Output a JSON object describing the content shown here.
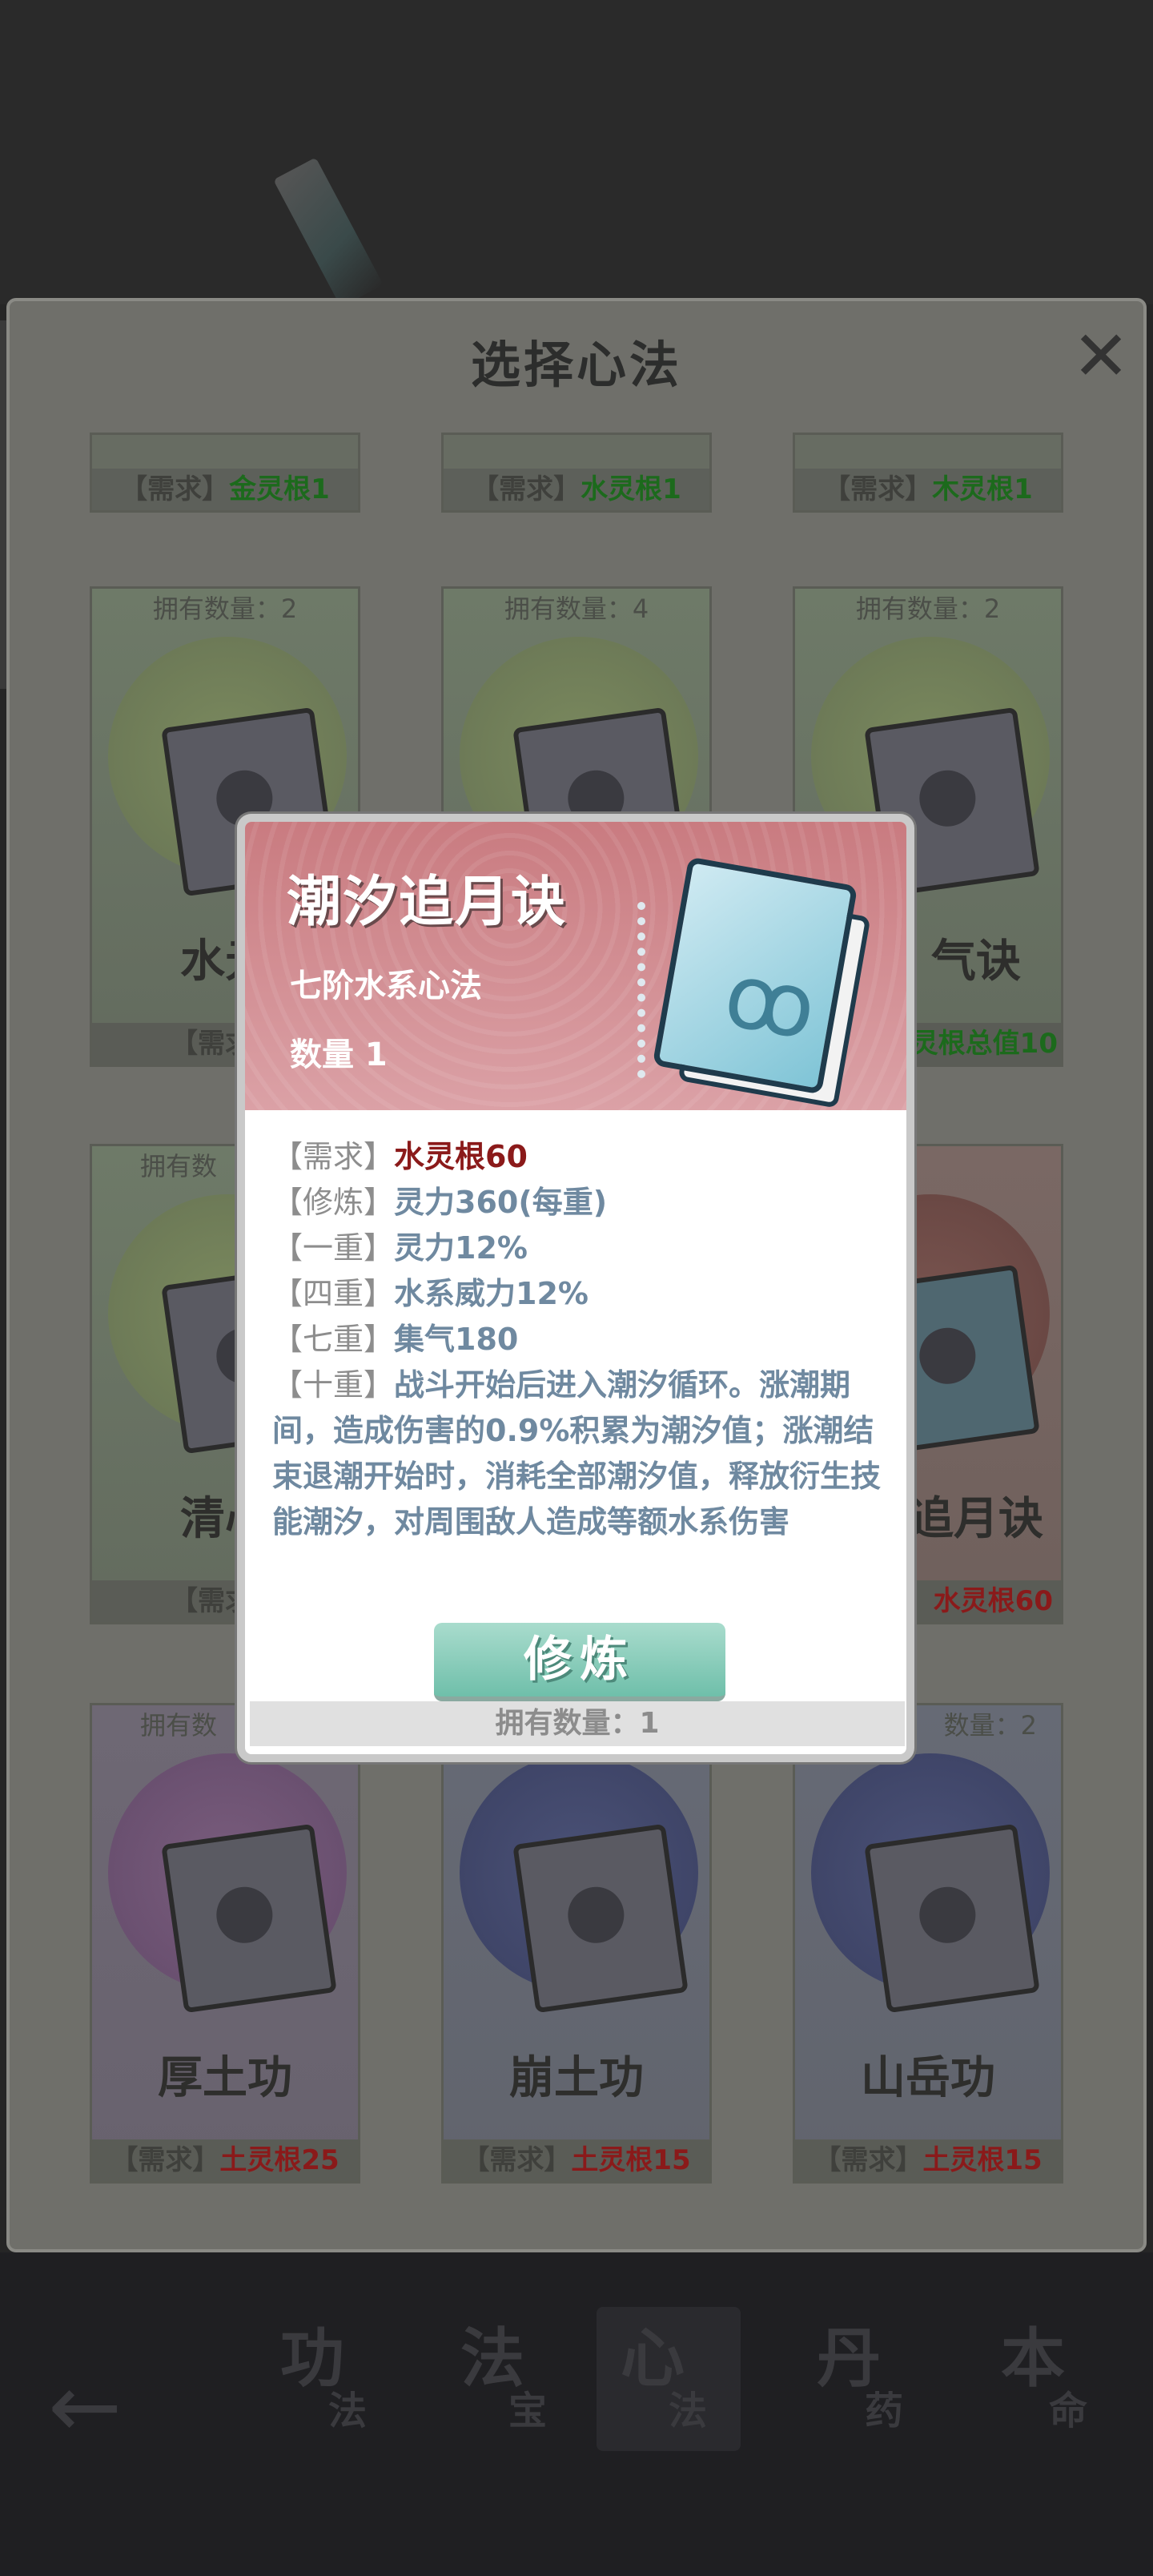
{
  "title": "选择心法",
  "top_row": [
    {
      "req_tag": "【需求】",
      "req_value": "金灵根1"
    },
    {
      "req_tag": "【需求】",
      "req_value": "水灵根1"
    },
    {
      "req_tag": "【需求】",
      "req_value": "木灵根1"
    }
  ],
  "row1": [
    {
      "owned": "拥有数量：2",
      "name": "水元",
      "req_tag": "【需求】",
      "req_value": ""
    },
    {
      "owned": "拥有数量：4",
      "name": "",
      "req_tag": "",
      "req_value": ""
    },
    {
      "owned": "拥有数量：2",
      "name": "气诀",
      "req_tag": "",
      "req_value": "灵根总值10"
    }
  ],
  "row2": [
    {
      "owned": "拥有数",
      "name": "清心",
      "req_tag": "【需求】",
      "req_value": ""
    },
    {
      "owned": "",
      "name": "追月诀",
      "req_tag": "",
      "req_value": "水灵根60"
    }
  ],
  "row3": [
    {
      "owned": "拥有数",
      "name": "厚土功",
      "req_tag": "【需求】",
      "req_value": "土灵根25"
    },
    {
      "owned": "",
      "name": "崩土功",
      "req_tag": "【需求】",
      "req_value": "土灵根15"
    },
    {
      "owned": "数量：2",
      "name": "山岳功",
      "req_tag": "【需求】",
      "req_value": "土灵根15"
    }
  ],
  "nav": {
    "tabs": [
      {
        "big": "功",
        "small": "法"
      },
      {
        "big": "法",
        "small": "宝"
      },
      {
        "big": "心",
        "small": "法"
      },
      {
        "big": "丹",
        "small": "药"
      },
      {
        "big": "本",
        "small": "命"
      }
    ]
  },
  "popup": {
    "title": "潮汐追月诀",
    "subtitle": "七阶水系心法",
    "quantity": "数量 1",
    "lines": [
      {
        "tag": "【需求】",
        "value": "水灵根60"
      },
      {
        "tag": "【修炼】",
        "value": "灵力360(每重)"
      },
      {
        "tag": "【一重】",
        "value": "灵力12%"
      },
      {
        "tag": "【四重】",
        "value": "水系威力12%"
      },
      {
        "tag": "【七重】",
        "value": "集气180"
      }
    ],
    "tenth_tag": "【十重】",
    "tenth_text": "战斗开始后进入潮汐循环。涨潮期间，造成伤害的0.9%积累为潮汐值；涨潮结束退潮开始时，消耗全部潮汐值，释放衍生技能潮汐，对周围敌人造成等额水系伤害",
    "button_label": "修炼",
    "owned_footer": "拥有数量：1"
  },
  "colors": {
    "accent_red": "#8b1a1a",
    "accent_green": "#1c6a1c",
    "button_teal": "#6fbfaa",
    "popup_header": "#c97b80"
  }
}
